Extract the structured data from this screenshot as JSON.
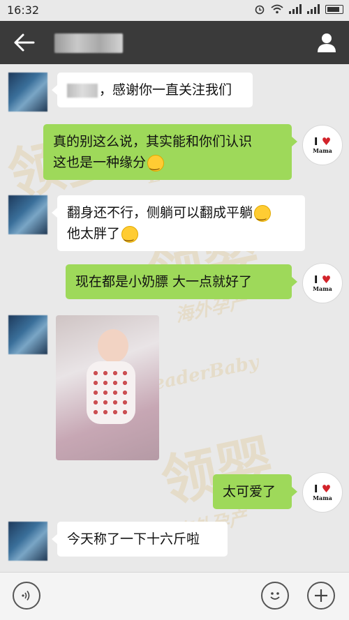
{
  "status_bar": {
    "time": "16:32"
  },
  "header": {
    "back_icon": "arrow-left-icon",
    "contact_name_blurred": true,
    "profile_icon": "person-icon"
  },
  "avatars": {
    "me_text_1": "I",
    "me_text_2": "Mama"
  },
  "watermarks": {
    "logo_text": "领婴",
    "brand_text": "LeaderBaby",
    "tagline": "海外孕产"
  },
  "messages": [
    {
      "side": "left",
      "text": "，感谢你一直关注我们"
    },
    {
      "side": "right",
      "line1": "真的别这么说，其实能和你们认识",
      "line2": "这也是一种缘分"
    },
    {
      "side": "left",
      "line1": "翻身还不行，侧躺可以翻成平躺",
      "line2": "他太胖了"
    },
    {
      "side": "right",
      "text": "现在都是小奶膘  大一点就好了"
    },
    {
      "side": "left",
      "type": "photo"
    },
    {
      "side": "right",
      "text": "太可爱了"
    },
    {
      "side": "left",
      "text": "今天称了一下十六斤啦"
    }
  ],
  "colors": {
    "header": "#3a3a3a",
    "bubble_right": "#9ed95a",
    "bubble_left": "#ffffff",
    "background": "#e9e9e9"
  },
  "toolbar": {
    "voice_icon": "voice-icon",
    "emoji_icon": "emoji-icon",
    "plus_icon": "plus-icon"
  }
}
